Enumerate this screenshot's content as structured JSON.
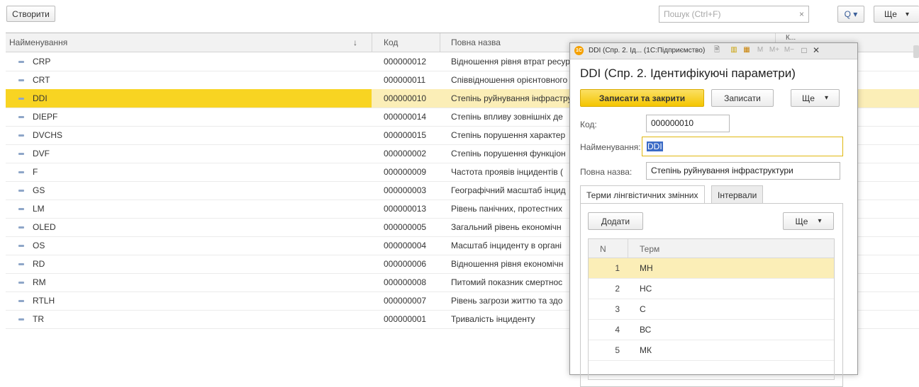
{
  "toolbar": {
    "create_label": "Створити",
    "search_placeholder": "Пошук (Ctrl+F)",
    "clear_label": "×",
    "search_button_label": "Q ▾",
    "more_label": "Ще",
    "more_arrow": "▾"
  },
  "list": {
    "columns": {
      "name": "Найменування",
      "sort_arrow": "↓",
      "code": "Код",
      "full_name": "Повна назва",
      "extra": "К..."
    },
    "rows": [
      {
        "name": "CRP",
        "code": "000000012",
        "full_name": "Відношення рівня втрат ресурсів"
      },
      {
        "name": "CRT",
        "code": "000000011",
        "full_name": "Співвідношення орієнтовного"
      },
      {
        "name": "DDI",
        "code": "000000010",
        "full_name": "Степінь руйнування інфраструктури"
      },
      {
        "name": "DIEPF",
        "code": "000000014",
        "full_name": "Степінь впливу зовнішніх де"
      },
      {
        "name": "DVCHS",
        "code": "000000015",
        "full_name": "Степінь порушення характер"
      },
      {
        "name": "DVF",
        "code": "000000002",
        "full_name": "Степінь порушення функціон"
      },
      {
        "name": "F",
        "code": "000000009",
        "full_name": "Частота проявів інцидентів ("
      },
      {
        "name": "GS",
        "code": "000000003",
        "full_name": "Географічний масштаб інцид"
      },
      {
        "name": "LM",
        "code": "000000013",
        "full_name": "Рівень панічних, протестних"
      },
      {
        "name": "OLED",
        "code": "000000005",
        "full_name": "Загальний рівень економічн"
      },
      {
        "name": "OS",
        "code": "000000004",
        "full_name": "Масштаб інциденту в органі"
      },
      {
        "name": "RD",
        "code": "000000006",
        "full_name": "Відношення рівня економічн"
      },
      {
        "name": "RM",
        "code": "000000008",
        "full_name": "Питомий показник смертнос"
      },
      {
        "name": "RTLH",
        "code": "000000007",
        "full_name": "Рівень загрози життю та здо"
      },
      {
        "name": "TR",
        "code": "000000001",
        "full_name": "Тривалість інциденту"
      }
    ]
  },
  "dialog": {
    "window_title": "DDI (Спр. 2. Ід... (1С:Підприємство)",
    "logo_text": "1С",
    "title_icons": [
      "🗎",
      "▥",
      "▦",
      "M",
      "M+",
      "M−",
      "□",
      "✕"
    ],
    "heading": "DDI (Спр. 2. Ідентифікуючі параметри)",
    "save_close_label": "Записати та закрити",
    "save_label": "Записати",
    "more_label": "Ще",
    "more_arrow": "▾",
    "code_label": "Код:",
    "code_value": "000000010",
    "name_label": "Найменування:",
    "name_value": "DDI",
    "full_name_label": "Повна назва:",
    "full_name_value": "Степінь руйнування інфраструктури",
    "tabs": [
      "Терми лінгвістичних змінних",
      "Інтервали"
    ],
    "add_label": "Додати",
    "terms_columns": {
      "n": "N",
      "term": "Терм"
    },
    "terms": [
      {
        "n": "1",
        "term": "МН"
      },
      {
        "n": "2",
        "term": "НС"
      },
      {
        "n": "3",
        "term": "С"
      },
      {
        "n": "4",
        "term": "ВС"
      },
      {
        "n": "5",
        "term": "МК"
      }
    ]
  },
  "colors": {
    "accent": "#f8d422",
    "selection": "#fbeeb7",
    "highlight": "#3b6bc6"
  }
}
